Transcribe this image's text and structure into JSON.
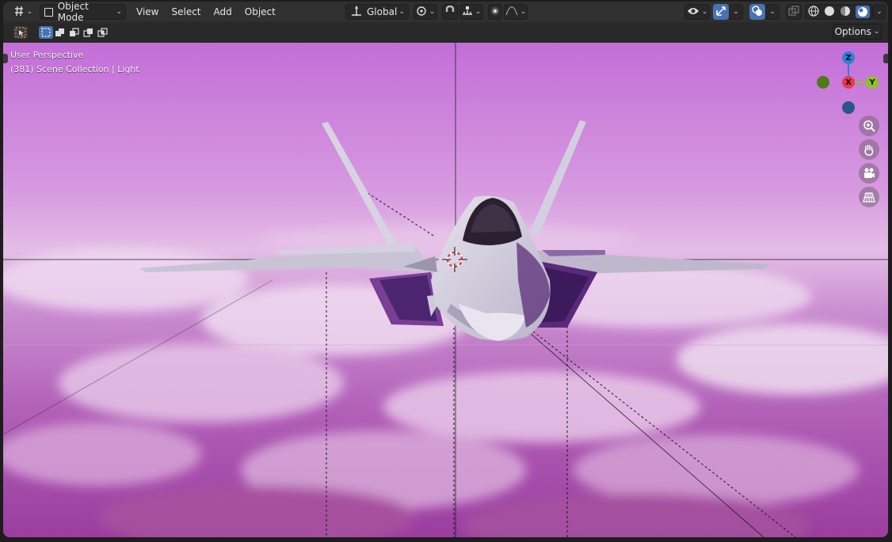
{
  "header": {
    "editor_type_icon": "viewport-editor-icon",
    "mode_label": "Object Mode",
    "menus": [
      "View",
      "Select",
      "Add",
      "Object"
    ],
    "orientation_label": "Global"
  },
  "toolbar": {
    "options_label": "Options"
  },
  "viewport": {
    "perspective_label": "User Perspective",
    "collection_label": "(381) Scene Collection | Light"
  },
  "gizmo": {
    "z_label": "Z",
    "x_label": "X",
    "y_label": "Y",
    "colors": {
      "z": "#2e7fd6",
      "x": "#e8384f",
      "y": "#8cc322",
      "neg_y": "#4d7a1c",
      "neg_z": "#2a5590"
    }
  },
  "nav_icons": [
    "zoom-icon",
    "pan-hand-icon",
    "camera-icon",
    "grid-ortho-icon"
  ],
  "colors": {
    "accent": "#4772b3",
    "sky_top": "#c770d8",
    "cloud_bottom": "#9a3a9c"
  }
}
